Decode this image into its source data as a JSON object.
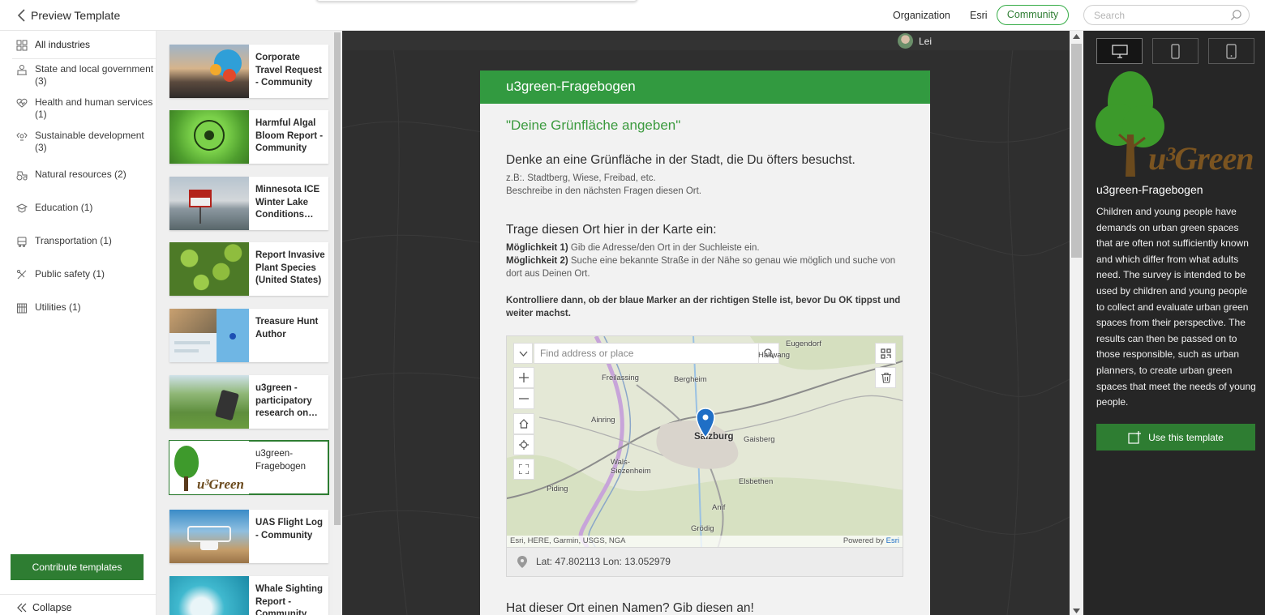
{
  "topbar": {
    "title": "Preview Template",
    "nav": [
      "Organization",
      "Esri",
      "Community"
    ],
    "search_placeholder": "Search"
  },
  "sidebar": {
    "all_label": "All industries",
    "items": [
      {
        "label": "State and local government (3)",
        "icon": "building-icon"
      },
      {
        "label": "Health and human services (1)",
        "icon": "heart-pulse-icon"
      },
      {
        "label": "Sustainable development (3)",
        "icon": "recycle-icon"
      },
      {
        "label": "Natural resources (2)",
        "icon": "tractor-icon"
      },
      {
        "label": "Education (1)",
        "icon": "mortarboard-icon"
      },
      {
        "label": "Transportation (1)",
        "icon": "bus-icon"
      },
      {
        "label": "Public safety (1)",
        "icon": "shield-icon"
      },
      {
        "label": "Utilities (1)",
        "icon": "utility-icon"
      }
    ],
    "contribute_label": "Contribute templates",
    "collapse_label": "Collapse"
  },
  "templates": [
    {
      "name": "Corporate Travel Request - Community"
    },
    {
      "name": "Harmful Algal Bloom Report - Community"
    },
    {
      "name": "Minnesota ICE Winter Lake Conditions…"
    },
    {
      "name": "Report Invasive Plant Species (United States)"
    },
    {
      "name": "Treasure Hunt Author"
    },
    {
      "name": "u3green - participatory research on…"
    },
    {
      "name": "u3green-Fragebogen",
      "selected": true
    },
    {
      "name": "UAS Flight Log - Community"
    },
    {
      "name": "Whale Sighting Report - Community"
    }
  ],
  "preview": {
    "user": "Lei",
    "form_header": "u3green-Fragebogen",
    "page_title": "\"Deine Grünfläche angeben\"",
    "q1_heading": "Denke an eine Grünfläche in der Stadt, die Du öfters besuchst.",
    "q1_line1": "z.B:. Stadtberg, Wiese, Freibad, etc.",
    "q1_line2": "Beschreibe in den nächsten Fragen diesen Ort.",
    "q2_heading": "Trage diesen Ort hier in der Karte ein:",
    "q2_opt1_label": "Möglichkeit 1)",
    "q2_opt1_text": " Gib die Adresse/den Ort in der Suchleiste ein.",
    "q2_opt2_label": "Möglichkeit 2)",
    "q2_opt2_text": " Suche eine bekannte Straße in der Nähe so genau wie möglich und suche von dort aus Deinen Ort.",
    "q2_note": "Kontrolliere dann, ob der blaue Marker an der richtigen Stelle ist, bevor Du OK tippst und weiter machst.",
    "map_search_placeholder": "Find address or place",
    "map_labels": [
      "Freilassing",
      "Bergheim",
      "Anif",
      "Salzburg",
      "Wals-Siezenheim",
      "Elsbethen",
      "Grödig",
      "Ainring",
      "Piding",
      "Gaisberg",
      "Hallwang",
      "Eugendorf"
    ],
    "map_attribution": "Esri, HERE, Garmin, USGS, NGA",
    "map_powered": "Powered by",
    "map_powered_link": "Esri",
    "coord_text": "Lat: 47.802113  Lon: 13.052979",
    "q4_heading": "Hat dieser Ort einen Namen? Gib diesen an!"
  },
  "info": {
    "logo_text": "u³Green",
    "title": "u3green-Fragebogen",
    "description": "Children and young people have demands on urban green spaces that are often not sufficiently known and which differ from what adults need. The survey is intended to be used by children and young people to collect and evaluate urban green spaces from their perspective. The results can then be passed on to those responsible, such as urban planners, to create urban green spaces that meet the needs of young people.",
    "use_label": "Use this template",
    "devices": [
      "desktop-icon",
      "phone-icon",
      "tablet-icon"
    ]
  },
  "colors": {
    "accent": "#2e7d32",
    "form_header": "#329a40",
    "map_marker": "#1f6fc6"
  }
}
